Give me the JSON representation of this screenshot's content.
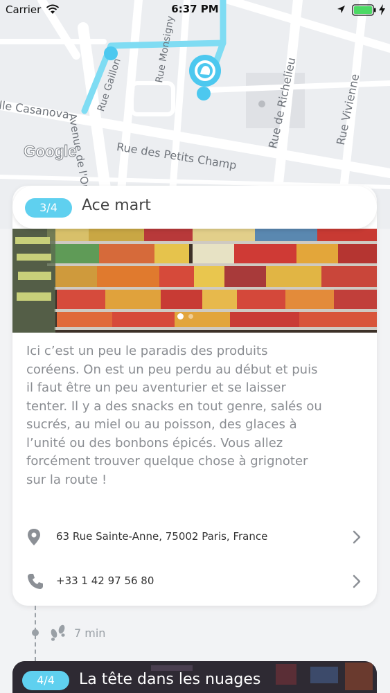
{
  "status_bar": {
    "carrier": "Carrier",
    "time": "6:37 PM"
  },
  "map": {
    "streets": [
      "Rue Gaillon",
      "Rue Monsigny",
      "Rue de Richelieu",
      "Rue Vivienne",
      "lle Casanova",
      "Avenue de l'Op",
      "Rue des Petits Champ"
    ],
    "logo": "Google",
    "route_color": "#7fdcf3",
    "marker_color": "#4cc8ef"
  },
  "card": {
    "step": "3/4",
    "title": "Ace mart",
    "description_lines": [
      "Ici c’est un peu le paradis des produits",
      "coréens. On est un peu perdu au début et puis",
      "il faut être un peu aventurier et se laisser",
      "tenter. Il y a des snacks en tout genre, salés ou",
      "sucrés, au miel ou au poisson, des glaces à",
      "l’unité ou des bonbons épicés. Vous allez",
      "forcément trouver quelque chose à grignoter",
      "sur la route !"
    ],
    "address": "63 Rue Sainte-Anne, 75002 Paris, France",
    "phone": "+33 1 42 97 56 80",
    "accent_color": "#5fd0ef"
  },
  "timeline": {
    "walk_time": "7 min"
  },
  "next_card": {
    "step": "4/4",
    "title": "La tête dans les nuages"
  }
}
